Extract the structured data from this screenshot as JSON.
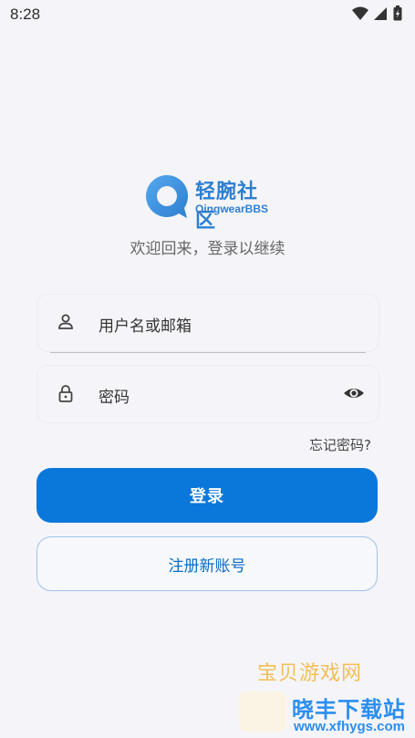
{
  "status": {
    "time": "8:28"
  },
  "brand": {
    "name": "轻腕社区",
    "subtitle": "QingwearBBS",
    "color": "#2d7fd0"
  },
  "tagline": "欢迎回来，登录以继续",
  "form": {
    "username_placeholder": "用户名或邮箱",
    "password_placeholder": "密码",
    "forgot_label": "忘记密码?",
    "login_label": "登录",
    "register_label": "注册新账号"
  },
  "watermark": {
    "top": "宝贝游戏网",
    "middle": "晓丰下载站",
    "url": "www.xfhygs.com"
  },
  "colors": {
    "primary": "#0a77db",
    "background": "#f5f5f9"
  }
}
